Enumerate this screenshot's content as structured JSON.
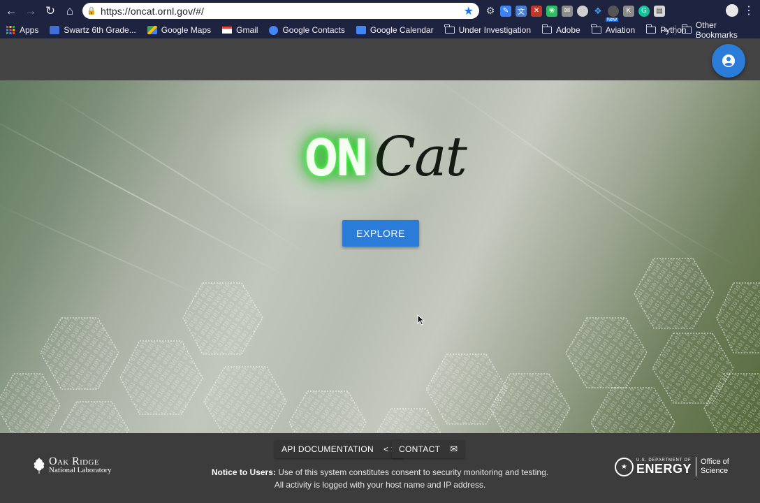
{
  "browser": {
    "url": "https://oncat.ornl.gov/#/",
    "extension_badge": "New",
    "bookmarks": [
      {
        "label": "Apps",
        "icon": "apps-grid-icon"
      },
      {
        "label": "Swartz 6th Grade...",
        "icon": "calendar-page-icon"
      },
      {
        "label": "Google Maps",
        "icon": "google-maps-icon"
      },
      {
        "label": "Gmail",
        "icon": "gmail-icon"
      },
      {
        "label": "Google Contacts",
        "icon": "contacts-icon"
      },
      {
        "label": "Google Calendar",
        "icon": "calendar-icon"
      },
      {
        "label": "Under Investigation",
        "icon": "folder-icon"
      },
      {
        "label": "Adobe",
        "icon": "folder-icon"
      },
      {
        "label": "Aviation",
        "icon": "folder-icon"
      },
      {
        "label": "Python",
        "icon": "folder-icon"
      }
    ],
    "overflow_label": "»",
    "other_bookmarks_label": "Other Bookmarks"
  },
  "hero": {
    "logo_on": "ON",
    "logo_cat": "Cat",
    "explore_label": "EXPLORE"
  },
  "footer": {
    "api_docs_label": "API DOCUMENTATION",
    "contact_label": "CONTACT",
    "notice_title": "Notice to Users:",
    "notice_text": "Use of this system constitutes consent to security monitoring and testing. All activity is logged with your host name and IP address.",
    "ornl_name": "Oak Ridge",
    "ornl_sub": "National Laboratory",
    "doe_small": "U.S. DEPARTMENT OF",
    "doe_big": "ENERGY",
    "doe_office_1": "Office of",
    "doe_office_2": "Science"
  },
  "colors": {
    "accent": "#2b7cd8",
    "app_bar": "#444444",
    "footer": "#3c3c3c",
    "browser_chrome": "#1e2340"
  }
}
